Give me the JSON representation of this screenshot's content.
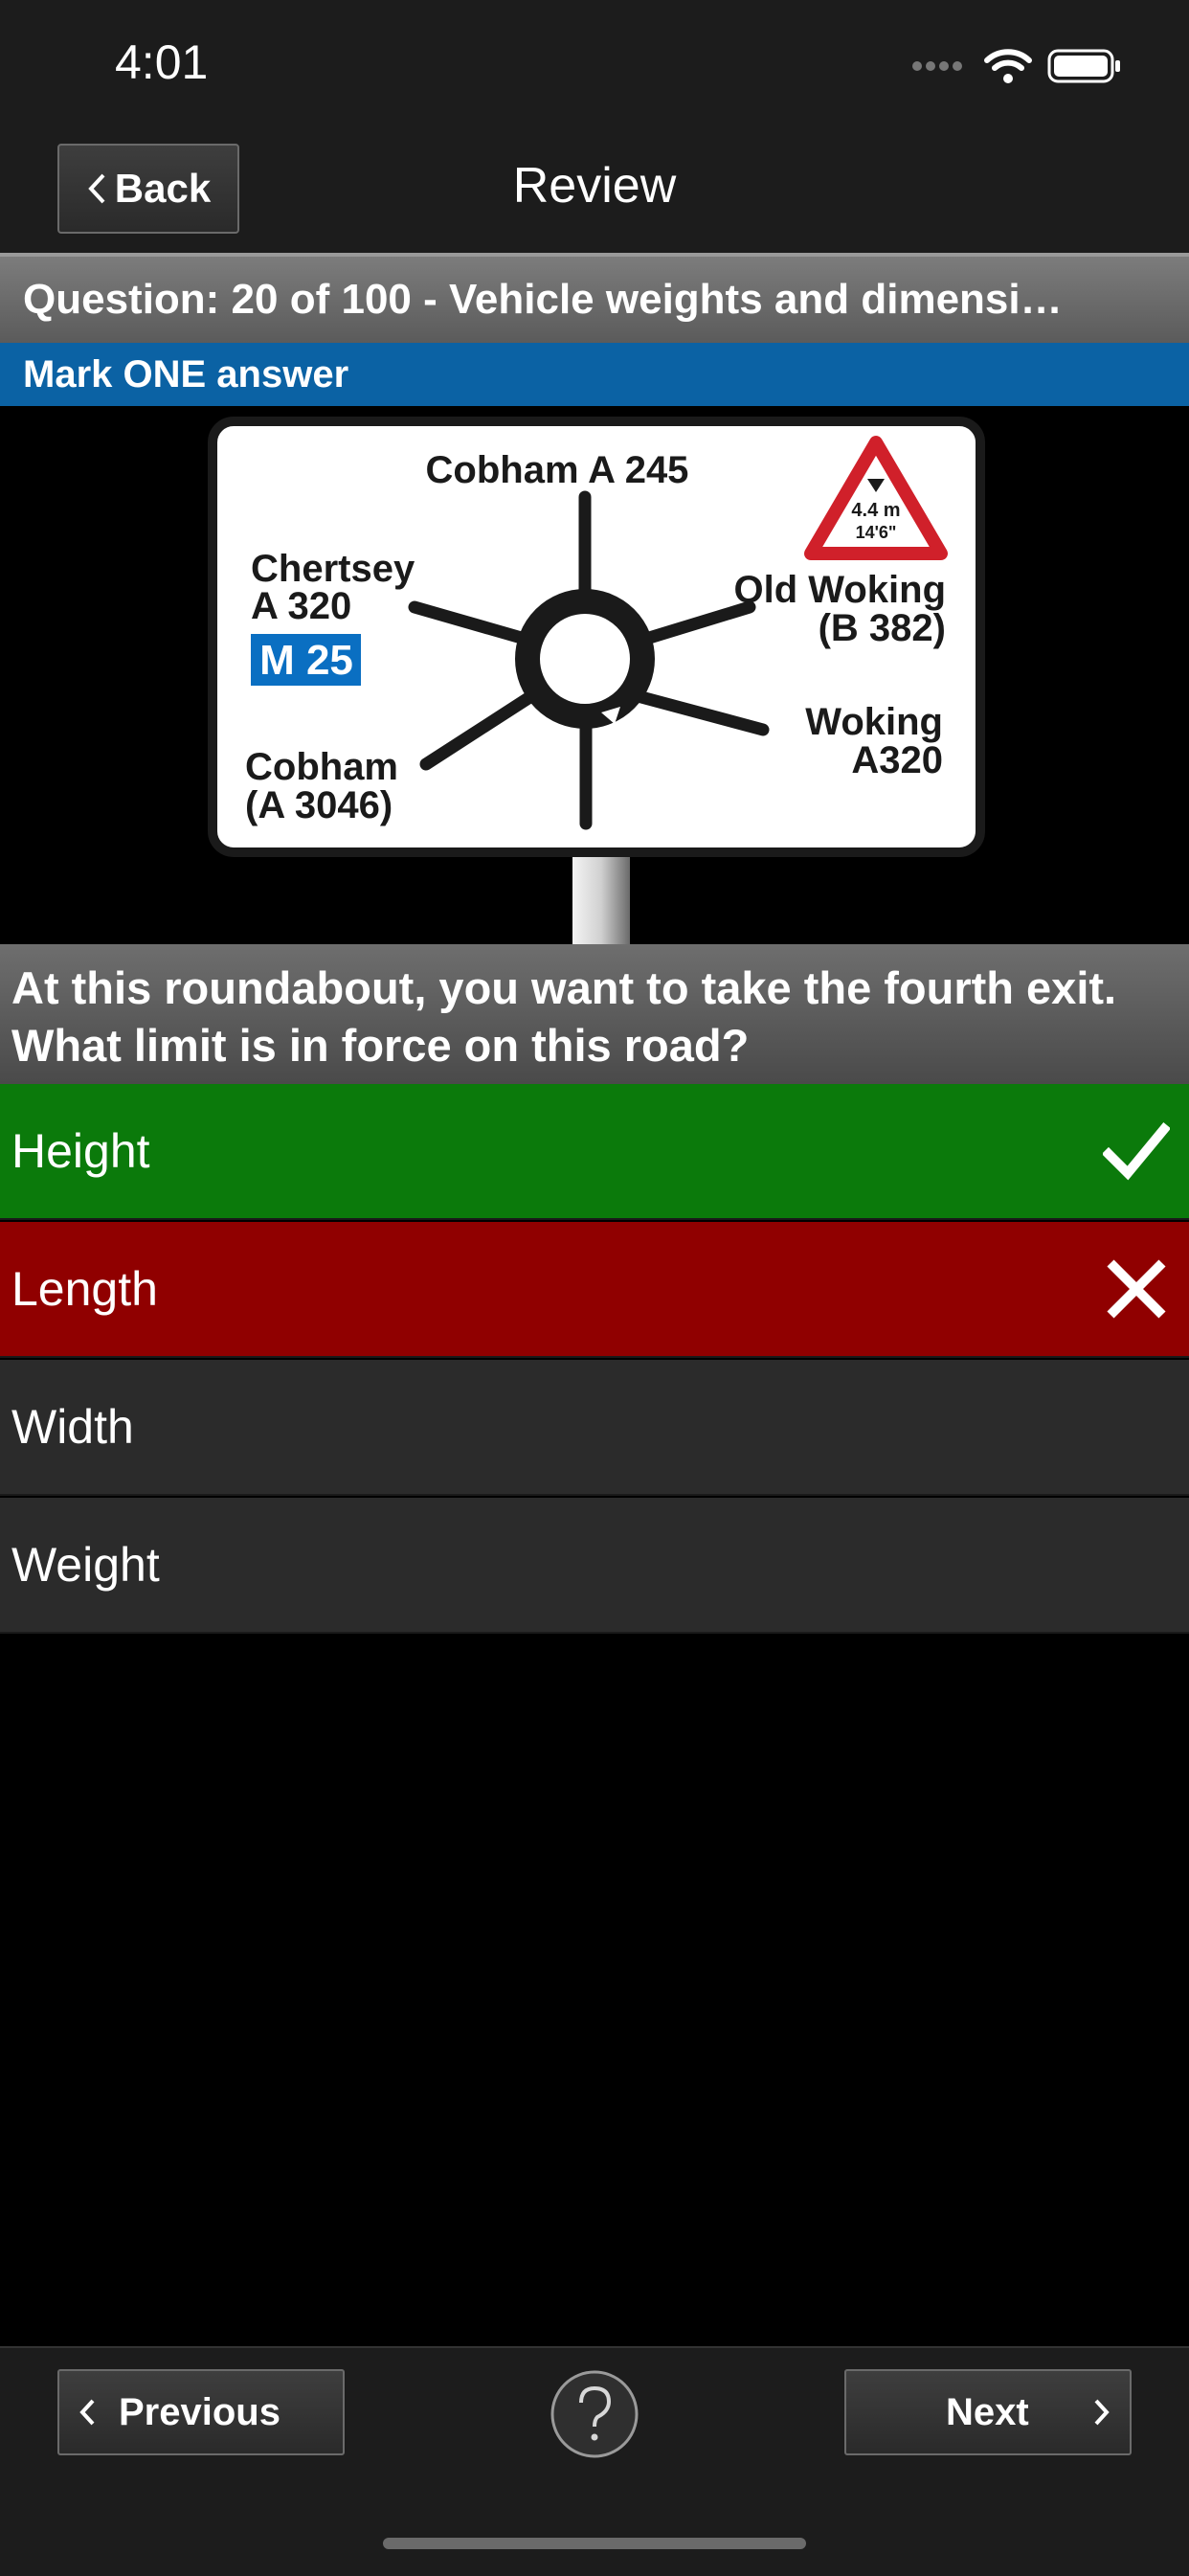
{
  "status_bar": {
    "time": "4:01"
  },
  "nav": {
    "back_label": "Back",
    "title": "Review"
  },
  "question": {
    "header": "Question: 20 of 100 - Vehicle weights and dimensi…",
    "instruction": "Mark ONE answer",
    "text": "At this roundabout, you want to take the fourth exit. What limit is in force on this road?"
  },
  "sign": {
    "top": "Cobham A 245",
    "left_top_1": "Chertsey",
    "left_top_2": "A 320",
    "motorway": "M 25",
    "right_top_1": "Old Woking",
    "right_top_2": "(B 382)",
    "left_bottom_1": "Cobham",
    "left_bottom_2": "(A 3046)",
    "right_bottom_1": "Woking",
    "right_bottom_2": "A320",
    "height_limit_1": "4.4 m",
    "height_limit_2": "14'6\""
  },
  "answers": [
    {
      "label": "Height",
      "state": "correct",
      "icon": "checkmark-icon"
    },
    {
      "label": "Length",
      "state": "incorrect",
      "icon": "cross-icon"
    },
    {
      "label": "Width",
      "state": "neutral"
    },
    {
      "label": "Weight",
      "state": "neutral"
    }
  ],
  "toolbar": {
    "previous_label": "Previous",
    "next_label": "Next",
    "help_icon": "question-mark-icon"
  },
  "colors": {
    "correct": "#0b7a0b",
    "incorrect": "#900000",
    "instruction_bar": "#0b62a4",
    "motorway_blue": "#0a6fc2",
    "warning_red": "#d0202a"
  }
}
